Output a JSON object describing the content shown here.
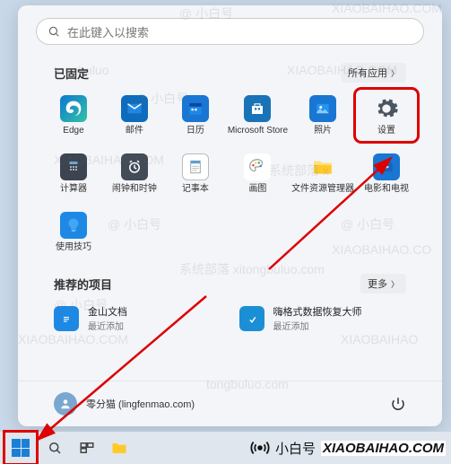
{
  "search": {
    "placeholder": "在此键入以搜索"
  },
  "sections": {
    "pinned_title": "已固定",
    "all_apps": "所有应用",
    "recommended_title": "推荐的项目",
    "more": "更多"
  },
  "apps": [
    {
      "id": "edge",
      "label": "Edge"
    },
    {
      "id": "mail",
      "label": "邮件"
    },
    {
      "id": "calendar",
      "label": "日历"
    },
    {
      "id": "store",
      "label": "Microsoft Store"
    },
    {
      "id": "photos",
      "label": "照片"
    },
    {
      "id": "settings",
      "label": "设置"
    },
    {
      "id": "calculator",
      "label": "计算器"
    },
    {
      "id": "clock",
      "label": "闹钟和时钟"
    },
    {
      "id": "notepad",
      "label": "记事本"
    },
    {
      "id": "paint",
      "label": "画图"
    },
    {
      "id": "explorer",
      "label": "文件资源管理器"
    },
    {
      "id": "movies",
      "label": "电影和电视"
    },
    {
      "id": "tips",
      "label": "使用技巧"
    }
  ],
  "recommended": [
    {
      "id": "wps",
      "title": "金山文档",
      "sub": "最近添加"
    },
    {
      "id": "recovery",
      "title": "嗨格式数据恢复大师",
      "sub": "最近添加"
    }
  ],
  "user": {
    "name": "零分猫 (lingfenmao.com)"
  },
  "branding": {
    "cn": "小白号",
    "en": "XIAOBAIHAO.COM"
  },
  "watermarks": [
    "@ 小白号",
    "XIAOBAIHAO.COM",
    "系统部落 xitongbuluo.com"
  ]
}
